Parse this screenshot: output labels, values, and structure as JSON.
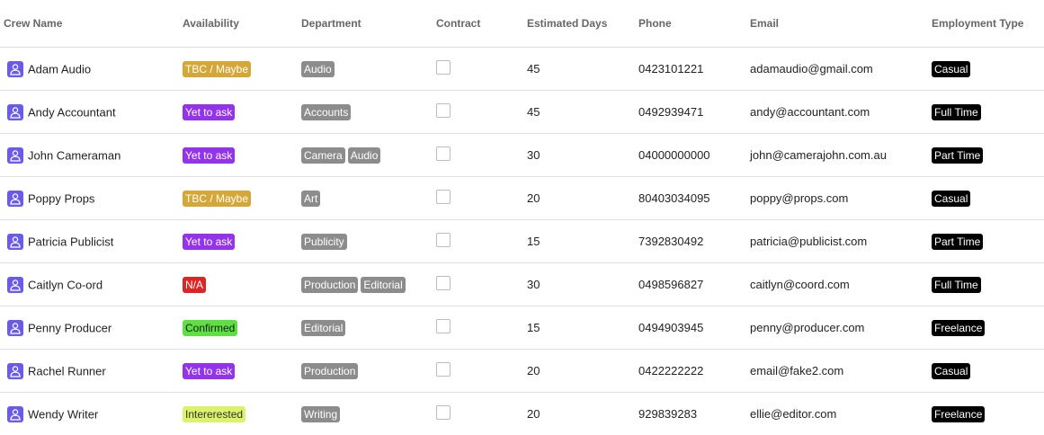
{
  "columns": {
    "name": "Crew Name",
    "availability": "Availability",
    "department": "Department",
    "contract": "Contract",
    "days": "Estimated Days",
    "phone": "Phone",
    "email": "Email",
    "employment": "Employment Type"
  },
  "colors": {
    "avatar": "#6b5ce7",
    "tbc": "#d4a838",
    "yet_to_ask": "#9333ea",
    "na": "#dc2626",
    "confirmed": "#5ee043",
    "interested": "#dcf26b",
    "department": "#8c8c8c",
    "employment": "#000000"
  },
  "rows": [
    {
      "name": "Adam Audio",
      "availability": {
        "label": "TBC / Maybe",
        "bg": "#d4a838",
        "fg": "#ffffff"
      },
      "departments": [
        "Audio"
      ],
      "contract": false,
      "days": "45",
      "phone": "0423101221",
      "email": "adamaudio@gmail.com",
      "employment": "Casual"
    },
    {
      "name": "Andy Accountant",
      "availability": {
        "label": "Yet to ask",
        "bg": "#9333ea",
        "fg": "#ffffff"
      },
      "departments": [
        "Accounts"
      ],
      "contract": false,
      "days": "45",
      "phone": "0492939471",
      "email": "andy@accountant.com",
      "employment": "Full Time"
    },
    {
      "name": "John Cameraman",
      "availability": {
        "label": "Yet to ask",
        "bg": "#9333ea",
        "fg": "#ffffff"
      },
      "departments": [
        "Camera",
        "Audio"
      ],
      "contract": false,
      "days": "30",
      "phone": "04000000000",
      "email": "john@camerajohn.com.au",
      "employment": "Part Time"
    },
    {
      "name": "Poppy Props",
      "availability": {
        "label": "TBC / Maybe",
        "bg": "#d4a838",
        "fg": "#ffffff"
      },
      "departments": [
        "Art"
      ],
      "contract": false,
      "days": "20",
      "phone": "80403034095",
      "email": "poppy@props.com",
      "employment": "Casual"
    },
    {
      "name": "Patricia Publicist",
      "availability": {
        "label": "Yet to ask",
        "bg": "#9333ea",
        "fg": "#ffffff"
      },
      "departments": [
        "Publicity"
      ],
      "contract": false,
      "days": "15",
      "phone": "7392830492",
      "email": "patricia@publicist.com",
      "employment": "Part Time"
    },
    {
      "name": "Caitlyn Co-ord",
      "availability": {
        "label": "N/A",
        "bg": "#dc2626",
        "fg": "#ffffff"
      },
      "departments": [
        "Production",
        "Editorial"
      ],
      "contract": false,
      "days": "30",
      "phone": "0498596827",
      "email": "caitlyn@coord.com",
      "employment": "Full Time"
    },
    {
      "name": "Penny Producer",
      "availability": {
        "label": "Confirmed",
        "bg": "#5ee043",
        "fg": "#1a1a1a"
      },
      "departments": [
        "Editorial"
      ],
      "contract": false,
      "days": "15",
      "phone": "0494903945",
      "email": "penny@producer.com",
      "employment": "Freelance"
    },
    {
      "name": "Rachel Runner",
      "availability": {
        "label": "Yet to ask",
        "bg": "#9333ea",
        "fg": "#ffffff"
      },
      "departments": [
        "Production"
      ],
      "contract": false,
      "days": "20",
      "phone": "0422222222",
      "email": "email@fake2.com",
      "employment": "Casual"
    },
    {
      "name": "Wendy Writer",
      "availability": {
        "label": "Intererested",
        "bg": "#dcf26b",
        "fg": "#333333"
      },
      "departments": [
        "Writing"
      ],
      "contract": false,
      "days": "20",
      "phone": "929839283",
      "email": "ellie@editor.com",
      "employment": "Freelance"
    }
  ]
}
